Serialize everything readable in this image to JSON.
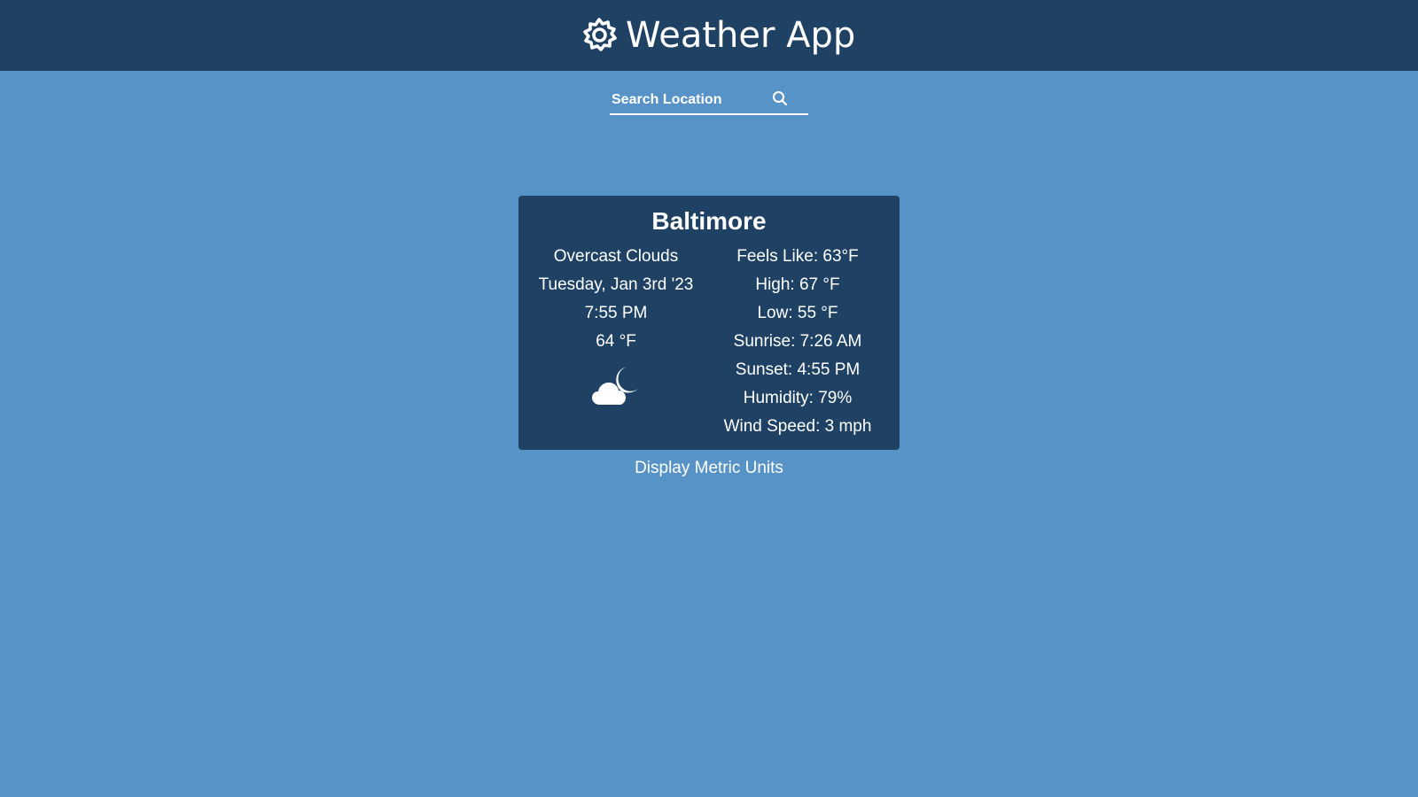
{
  "header": {
    "title": "Weather App",
    "icon": "gear-icon"
  },
  "search": {
    "placeholder": "Search Location",
    "value": "",
    "button_icon": "search-icon"
  },
  "weather": {
    "city": "Baltimore",
    "description": "Overcast Clouds",
    "date": "Tuesday, Jan 3rd '23",
    "time": "7:55 PM",
    "temperature": "64 °F",
    "icon": "cloud-moon-icon",
    "details": [
      "Feels Like: 63°F",
      "High: 67 °F",
      "Low: 55 °F",
      "Sunrise: 7:26 AM",
      "Sunset: 4:55 PM",
      "Humidity: 79%",
      "Wind Speed: 3 mph"
    ]
  },
  "units_toggle": {
    "label": "Display Metric Units"
  },
  "colors": {
    "background": "#5793c6",
    "header": "#1f4163",
    "card": "#1f4163",
    "text": "#ffffff"
  }
}
